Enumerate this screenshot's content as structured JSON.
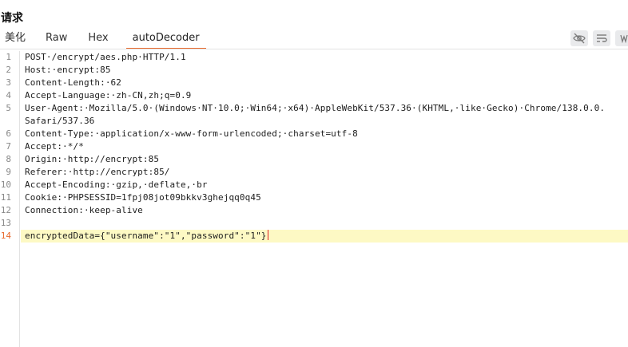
{
  "title": "请求",
  "tabs": [
    "美化",
    "Raw",
    "Hex",
    "autoDecoder"
  ],
  "active_tab": "autoDecoder",
  "toolbar": {
    "icons": [
      "eye-slash-icon",
      "wrap-lines-icon",
      "newline-icon"
    ]
  },
  "editor": {
    "line_numbers": [
      "1",
      "2",
      "3",
      "4",
      "5",
      "",
      "6",
      "7",
      "8",
      "9",
      "10",
      "11",
      "12",
      "13",
      "14"
    ],
    "lines": [
      "POST·/encrypt/aes.php·HTTP/1.1",
      "Host:·encrypt:85",
      "Content-Length:·62",
      "Accept-Language:·zh-CN,zh;q=0.9",
      "User-Agent:·Mozilla/5.0·(Windows·NT·10.0;·Win64;·x64)·AppleWebKit/537.36·(KHTML,·like·Gecko)·Chrome/138.0.0.",
      "Safari/537.36",
      "Content-Type:·application/x-www-form-urlencoded;·charset=utf-8",
      "Accept:·*/*",
      "Origin:·http://encrypt:85",
      "Referer:·http://encrypt:85/",
      "Accept-Encoding:·gzip,·deflate,·br",
      "Cookie:·PHPSESSID=1fpj08jot09bkkv3ghejqq0q45",
      "Connection:·keep-alive",
      "",
      "encryptedData={\"username\":\"1\",\"password\":\"1\"}"
    ],
    "current_line": "14"
  }
}
